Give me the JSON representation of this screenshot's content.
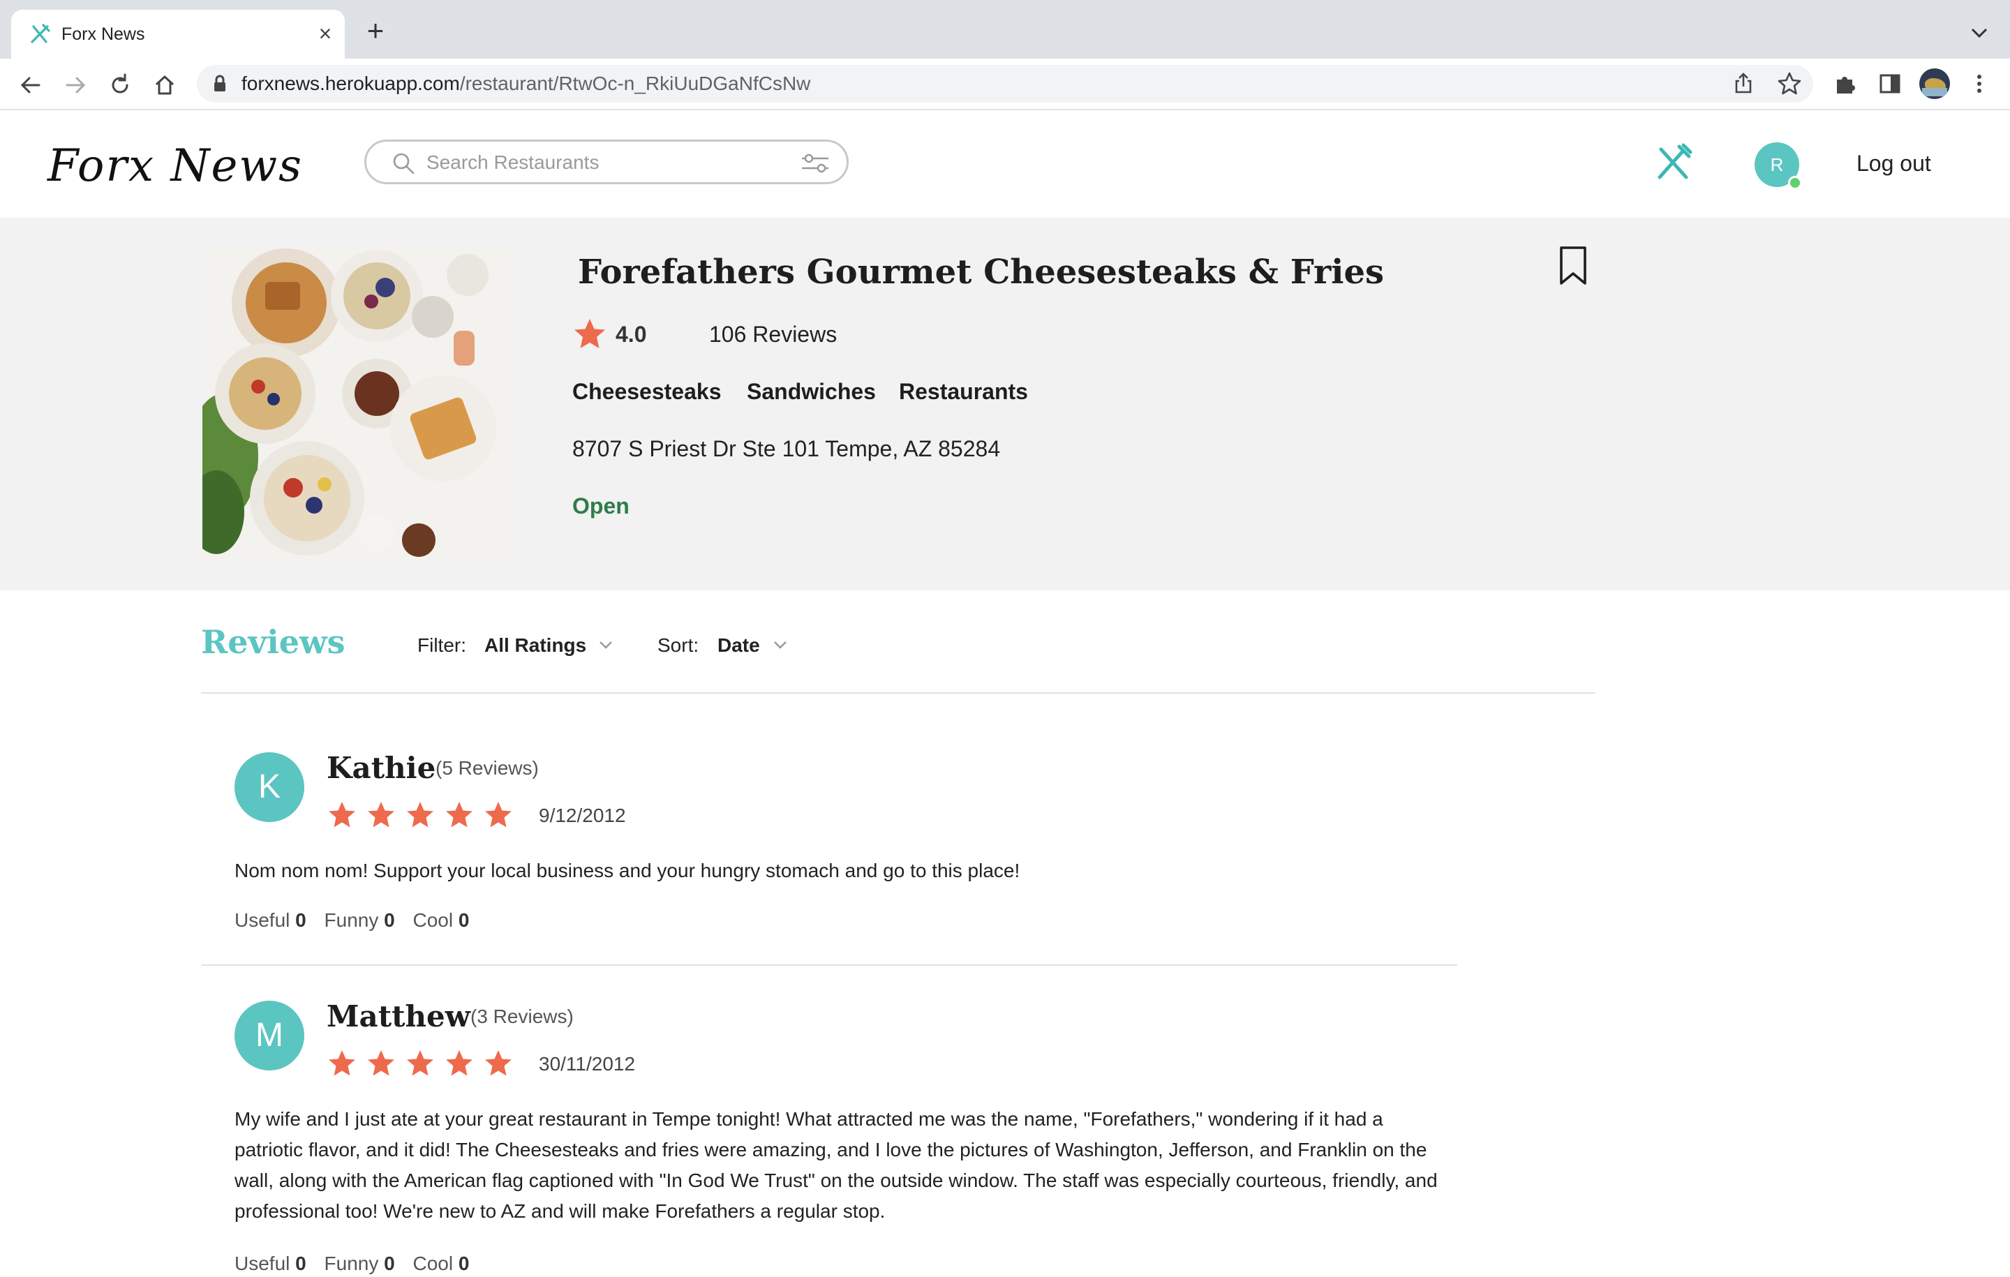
{
  "browser": {
    "tab_title": "Forx News",
    "url_host": "forxnews.herokuapp.com",
    "url_path": "/restaurant/RtwOc-n_RkiUuDGaNfCsNw"
  },
  "header": {
    "logo_text": "Forx News",
    "search_placeholder": "Search Restaurants",
    "avatar_initial": "R",
    "logout_label": "Log out"
  },
  "restaurant": {
    "name": "Forefathers Gourmet Cheesesteaks & Fries",
    "rating": "4.0",
    "review_count": "106 Reviews",
    "categories": [
      "Cheesesteaks",
      "Sandwiches",
      "Restaurants"
    ],
    "address": "8707 S Priest Dr Ste 101 Tempe, AZ 85284",
    "status": "Open",
    "status_color": "#2e7d4a"
  },
  "reviews_section": {
    "title": "Reviews",
    "filter_label": "Filter:",
    "filter_value": "All Ratings",
    "sort_label": "Sort:",
    "sort_value": "Date"
  },
  "reviews": [
    {
      "initial": "K",
      "name": "Kathie",
      "user_review_count": "(5 Reviews)",
      "stars": 5,
      "date": "9/12/2012",
      "text": "Nom nom nom! Support your local business and your hungry stomach and go to this place!",
      "useful_label": "Useful",
      "useful": "0",
      "funny_label": "Funny",
      "funny": "0",
      "cool_label": "Cool",
      "cool": "0"
    },
    {
      "initial": "M",
      "name": "Matthew",
      "user_review_count": "(3 Reviews)",
      "stars": 5,
      "date": "30/11/2012",
      "text": "My wife and I just ate at your great restaurant in Tempe tonight! What attracted me was the name, \"Forefathers,\" wondering if it had a patriotic flavor, and it did! The Cheesesteaks and fries were amazing, and I love the pictures of Washington, Jefferson, and Franklin on the wall, along with the American flag captioned with \"In God We Trust\" on the outside window. The staff was especially courteous, friendly, and professional too! We're new to AZ and will make Forefathers a regular stop.",
      "useful_label": "Useful",
      "useful": "0",
      "funny_label": "Funny",
      "funny": "0",
      "cool_label": "Cool",
      "cool": "0"
    }
  ],
  "colors": {
    "accent": "#5bc5c2",
    "star": "#ee6a4d",
    "banner_bg": "#f2f2f2"
  }
}
